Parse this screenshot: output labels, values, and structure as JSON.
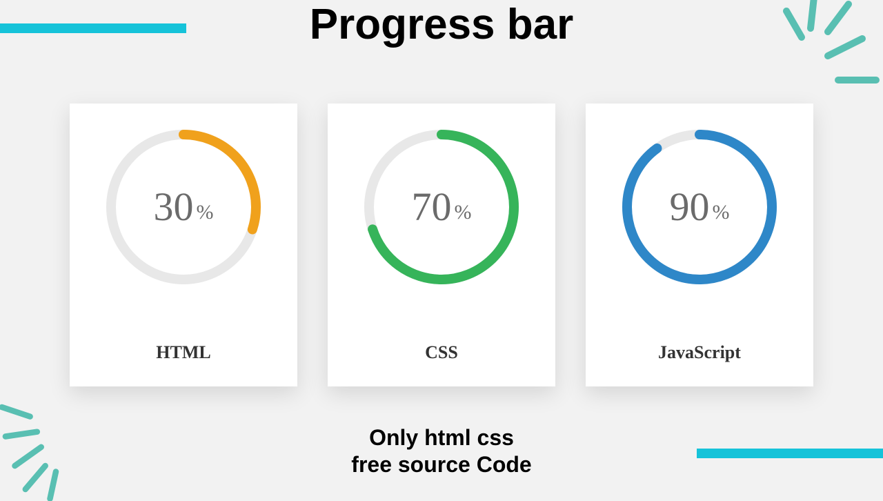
{
  "title": "Progress bar",
  "subtitle_line1": "Only html css",
  "subtitle_line2": "free source Code",
  "percent_sign": "%",
  "colors": {
    "track": "#e8e8e8",
    "accent": "#16c3d9"
  },
  "cards": [
    {
      "label": "HTML",
      "value": 30,
      "color": "#f0a11c"
    },
    {
      "label": "CSS",
      "value": 70,
      "color": "#36b45a"
    },
    {
      "label": "JavaScript",
      "value": 90,
      "color": "#2e87c8"
    }
  ],
  "chart_data": {
    "type": "bar",
    "title": "Progress bar",
    "categories": [
      "HTML",
      "CSS",
      "JavaScript"
    ],
    "values": [
      30,
      70,
      90
    ],
    "ylabel": "percent",
    "ylim": [
      0,
      100
    ]
  }
}
